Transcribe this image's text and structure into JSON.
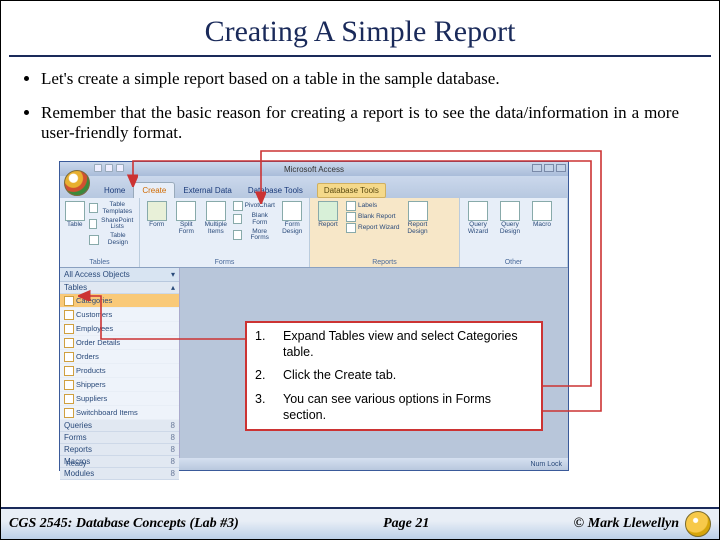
{
  "title": "Creating A Simple Report",
  "bullets": [
    "Let's create a simple report based on a table in the sample database.",
    "Remember that the basic reason for creating a report is to see the data/information in a more user-friendly format."
  ],
  "screenshot": {
    "app_title": "Microsoft Access",
    "db_tools_label": "Database Tools",
    "tabs": [
      "Home",
      "Create",
      "External Data",
      "Database Tools"
    ],
    "active_tab": "Create",
    "ribbon_groups": {
      "tables": {
        "label": "Tables",
        "items": [
          "Table",
          "Table Templates",
          "SharePoint Lists",
          "Table Design"
        ]
      },
      "forms": {
        "label": "Forms",
        "items": [
          "Form",
          "Split Form",
          "Multiple Items",
          "PivotChart",
          "Blank Form",
          "More Forms",
          "Form Design"
        ]
      },
      "reports": {
        "label": "Reports",
        "items": [
          "Report",
          "Labels",
          "Blank Report",
          "Report Wizard",
          "Report Design"
        ]
      },
      "other": {
        "label": "Other",
        "items": [
          "Query Wizard",
          "Query Design",
          "Macro"
        ]
      }
    },
    "nav": {
      "header": "All Access Objects",
      "sections": [
        {
          "name": "Tables",
          "count": "",
          "selected": false,
          "items": [
            "Categories",
            "Customers",
            "Employees",
            "Order Details",
            "Orders",
            "Products",
            "Shippers",
            "Suppliers",
            "Switchboard Items"
          ],
          "selected_item": "Categories"
        },
        {
          "name": "Queries",
          "count": "8"
        },
        {
          "name": "Forms",
          "count": "8"
        },
        {
          "name": "Reports",
          "count": "8"
        },
        {
          "name": "Macros",
          "count": "8"
        },
        {
          "name": "Modules",
          "count": "8"
        }
      ]
    },
    "status_left": "Ready",
    "status_right": "Num Lock"
  },
  "instructions": [
    {
      "n": "1.",
      "t": "Expand Tables view and select Categories table."
    },
    {
      "n": "2.",
      "t": "Click the Create tab."
    },
    {
      "n": "3.",
      "t": "You can see various options in Forms section."
    }
  ],
  "footer": {
    "left": "CGS 2545: Database Concepts  (Lab #3)",
    "center": "Page 21",
    "right": "© Mark Llewellyn"
  }
}
